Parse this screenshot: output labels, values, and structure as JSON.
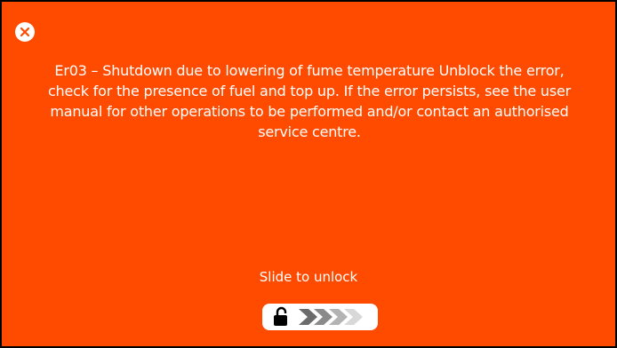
{
  "dialog": {
    "close_icon": "close-circle-icon",
    "message": "Er03 – Shutdown due to lowering of fume temperature Unblock the error, check for the presence of fuel and top up. If the error persists, see the user manual for other operations to be performed and/or contact an authorised service centre.",
    "slide_label": "Slide to unlock",
    "slider_handle_icon": "unlocked-padlock-icon",
    "slider_track_icon": "chevron-right-icon"
  },
  "colors": {
    "background": "#ff4b00",
    "text": "#ffffff",
    "border": "#000000",
    "chevron_shades": [
      "#6b6b6b",
      "#8a8a8a",
      "#b3b3b3",
      "#d8d8d8"
    ]
  }
}
